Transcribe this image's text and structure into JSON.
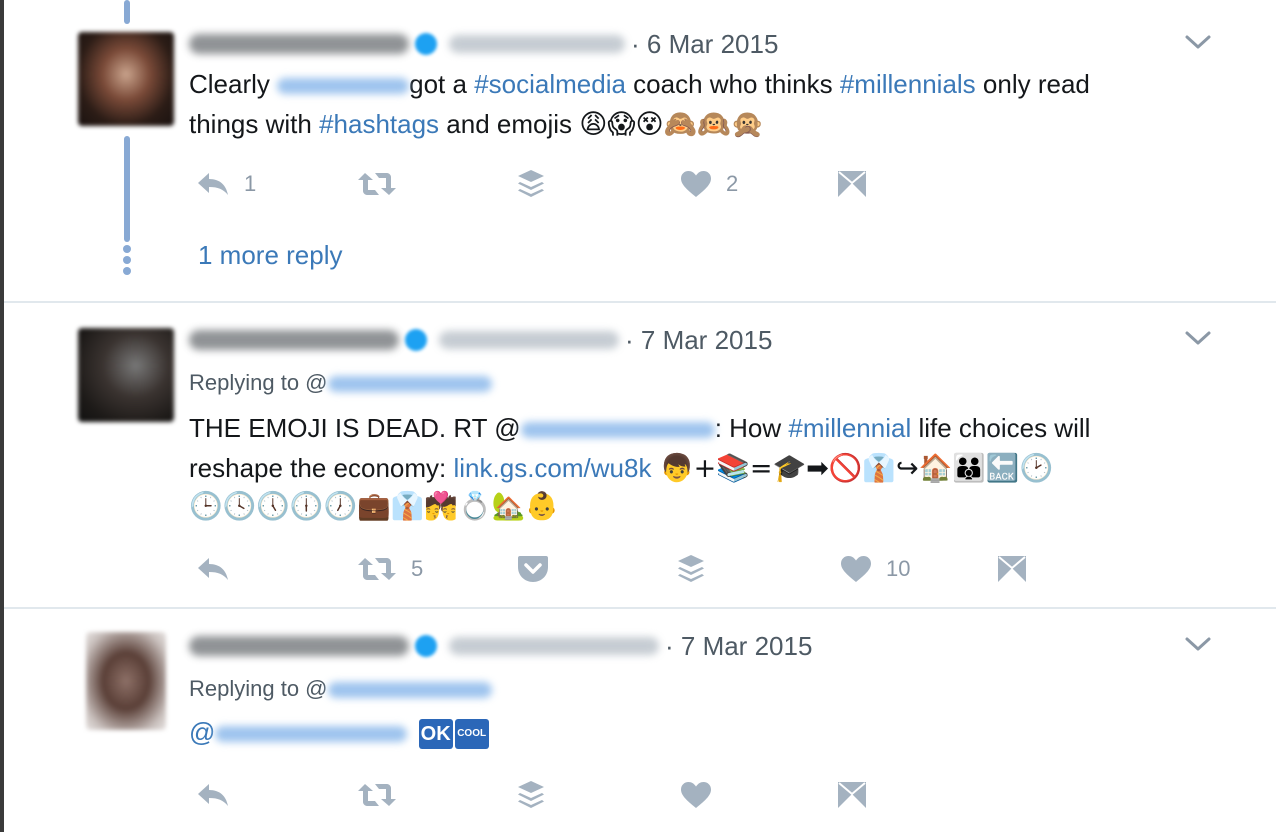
{
  "tweets": [
    {
      "date": "· 6 Mar 2015",
      "text_line1": {
        "pre": "Clearly ",
        "post": "got a ",
        "tag1": "#socialmedia",
        "mid": " coach who thinks ",
        "tag2": "#millennials",
        "end": " only read"
      },
      "text_line2": {
        "pre": "things with ",
        "tag": "#hashtags",
        "post": " and emojis ",
        "emojis": "😩😱😵🙈🙉🙊"
      },
      "reply_count": "1",
      "like_count": "2",
      "more_reply": "1 more reply"
    },
    {
      "date": "· 7 Mar 2015",
      "replying_to": "Replying to @",
      "text_line1": {
        "pre": "THE EMOJI IS DEAD. RT @",
        "post": ": How ",
        "tag": "#millennial",
        "end": " life choices will"
      },
      "text_line2": {
        "pre": "reshape the economy: ",
        "link": "link.gs.com/wu8k",
        "emojis": " 👦+📚=🎓➡🚫👔↪🏠👪🔙🕑"
      },
      "text_line3": {
        "emojis": "🕒🕓🕔🕕🕖💼👔💏💍🏡👶"
      },
      "retweet_count": "5",
      "like_count": "10"
    },
    {
      "date": "· 7 Mar 2015",
      "replying_to": "Replying to @",
      "text_line1": {
        "pre": "@",
        "badge_ok": "OK",
        "badge_cool": "COOL"
      }
    }
  ],
  "icons": {
    "reply": "reply-icon",
    "retweet": "retweet-icon",
    "buffer": "buffer-icon",
    "like": "heart-icon",
    "dm": "direct-message-icon",
    "pocket": "pocket-icon",
    "caret": "chevron-down-icon"
  },
  "colors": {
    "link": "#3b79b8",
    "icon": "#a4b2c0",
    "thread_line": "#88a9d4",
    "date": "#4e5a64",
    "divider": "#e1e8ed"
  }
}
